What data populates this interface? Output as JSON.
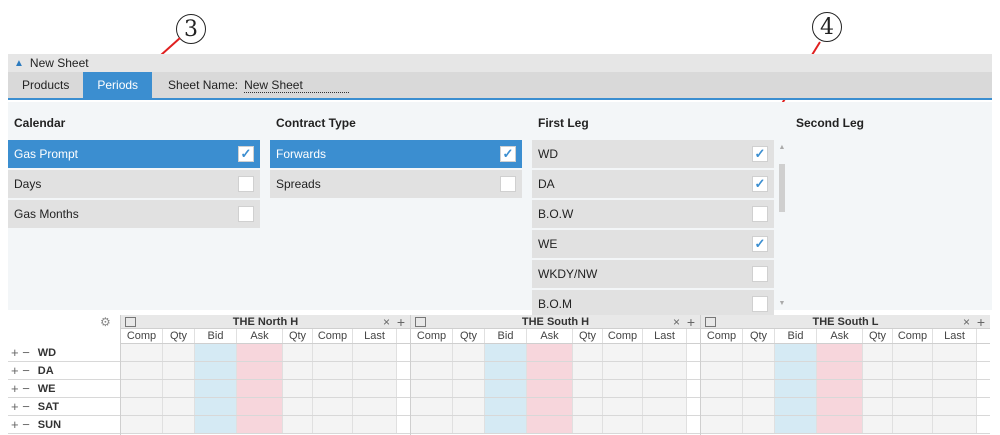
{
  "callouts": {
    "three": "3",
    "four": "4"
  },
  "header": {
    "title": "New Sheet"
  },
  "tabs": [
    {
      "label": "Products"
    },
    {
      "label": "Periods"
    }
  ],
  "sheet_name": {
    "label": "Sheet Name:",
    "value": "New Sheet"
  },
  "calendar": {
    "title": "Calendar",
    "items": [
      {
        "label": "Gas Prompt",
        "checked": true,
        "selected": true
      },
      {
        "label": "Days",
        "checked": false
      },
      {
        "label": "Gas Months",
        "checked": false
      }
    ]
  },
  "contract_type": {
    "title": "Contract Type",
    "items": [
      {
        "label": "Forwards",
        "checked": true,
        "selected": true
      },
      {
        "label": "Spreads",
        "checked": false
      }
    ]
  },
  "first_leg": {
    "title": "First Leg",
    "items": [
      {
        "label": "WD",
        "checked": true
      },
      {
        "label": "DA",
        "checked": true
      },
      {
        "label": "B.O.W",
        "checked": false
      },
      {
        "label": "WE",
        "checked": true
      },
      {
        "label": "WKDY/NW",
        "checked": false
      },
      {
        "label": "B.O.M",
        "checked": false
      }
    ]
  },
  "second_leg": {
    "title": "Second Leg"
  },
  "grid": {
    "panels": [
      {
        "name": "THE North H"
      },
      {
        "name": "THE South H"
      },
      {
        "name": "THE South L"
      }
    ],
    "columns": [
      "Comp",
      "Qty",
      "Bid",
      "Ask",
      "Qty",
      "Comp",
      "Last"
    ],
    "rows": [
      "WD",
      "DA",
      "WE",
      "SAT",
      "SUN"
    ],
    "row_controls": "+ −",
    "close_glyph": "×",
    "add_glyph": "+"
  },
  "colors": {
    "accent": "#3b8ed0",
    "bid": "#d5eaf4",
    "ask": "#f7d6dc",
    "arrow": "#e02020"
  }
}
